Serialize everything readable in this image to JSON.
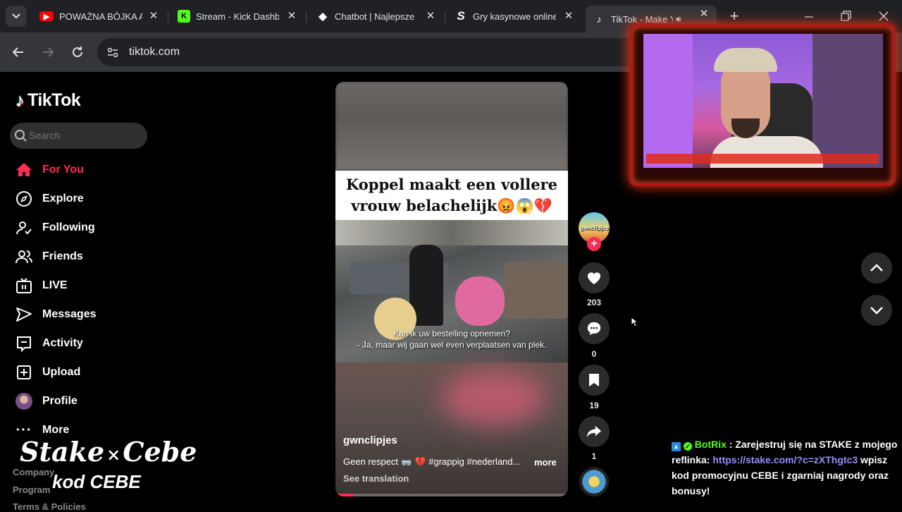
{
  "browser": {
    "tabs": [
      {
        "title": "POWAŻNA BÓJKA A",
        "favicon": "youtube-icon",
        "color": "#ff0000"
      },
      {
        "title": "Stream - Kick Dashb",
        "favicon": "kick-icon",
        "color": "#53fc18"
      },
      {
        "title": "Chatbot | Najlepsze",
        "favicon": "chatbot-icon",
        "color": "#ffffff"
      },
      {
        "title": "Gry kasynowe online",
        "favicon": "stake-icon",
        "color": "#ffffff"
      },
      {
        "title": "TikTok - Make Y",
        "favicon": "tiktok-icon",
        "color": "#ffffff",
        "active": true
      }
    ],
    "url": "tiktok.com"
  },
  "tiktok": {
    "logo": "TikTok",
    "search_placeholder": "Search",
    "nav": [
      {
        "label": "For You",
        "icon": "home-icon",
        "active": true
      },
      {
        "label": "Explore",
        "icon": "compass-icon"
      },
      {
        "label": "Following",
        "icon": "following-icon"
      },
      {
        "label": "Friends",
        "icon": "friends-icon"
      },
      {
        "label": "LIVE",
        "icon": "live-icon"
      },
      {
        "label": "Messages",
        "icon": "messages-icon"
      },
      {
        "label": "Activity",
        "icon": "activity-icon"
      },
      {
        "label": "Upload",
        "icon": "upload-icon"
      },
      {
        "label": "Profile",
        "icon": "avatar"
      },
      {
        "label": "More",
        "icon": "more-icon"
      }
    ],
    "footer": [
      "Company",
      "Program",
      "Terms & Policies"
    ],
    "accent": "#fe2c55"
  },
  "video": {
    "caption_line1": "Koppel maakt een vollere",
    "caption_line2": "vrouw belachelijk😡😱💔",
    "subtitle_line1": "Kan ik uw bestelling opnemen?",
    "subtitle_line2": "- Ja, maar wij gaan wel even verplaatsen van plek.",
    "author": "gwnclipjes",
    "description": "Geen respect 🥽 💔 #grappig #nederland...",
    "more": "more",
    "see_translation": "See translation",
    "likes": "203",
    "comments": "0",
    "saves": "19",
    "shares": "1",
    "avatar_text": "gwnclipjes"
  },
  "overlay": {
    "stake_brand": "Stake",
    "x": "×",
    "streamer": "Cebe",
    "code": "kod CEBE"
  },
  "chat": {
    "user": "BotRix",
    "separator": ":",
    "text_before": "Zarejestruj się na STAKE z mojego reflinka:",
    "link": "https://stake.com/?c=zXThgtc3",
    "text_after": "wpisz kod promocyjnu CEBE i zgarniaj nagrody oraz bonusy!",
    "user_color": "#53fc18",
    "link_color": "#9b8cff"
  }
}
